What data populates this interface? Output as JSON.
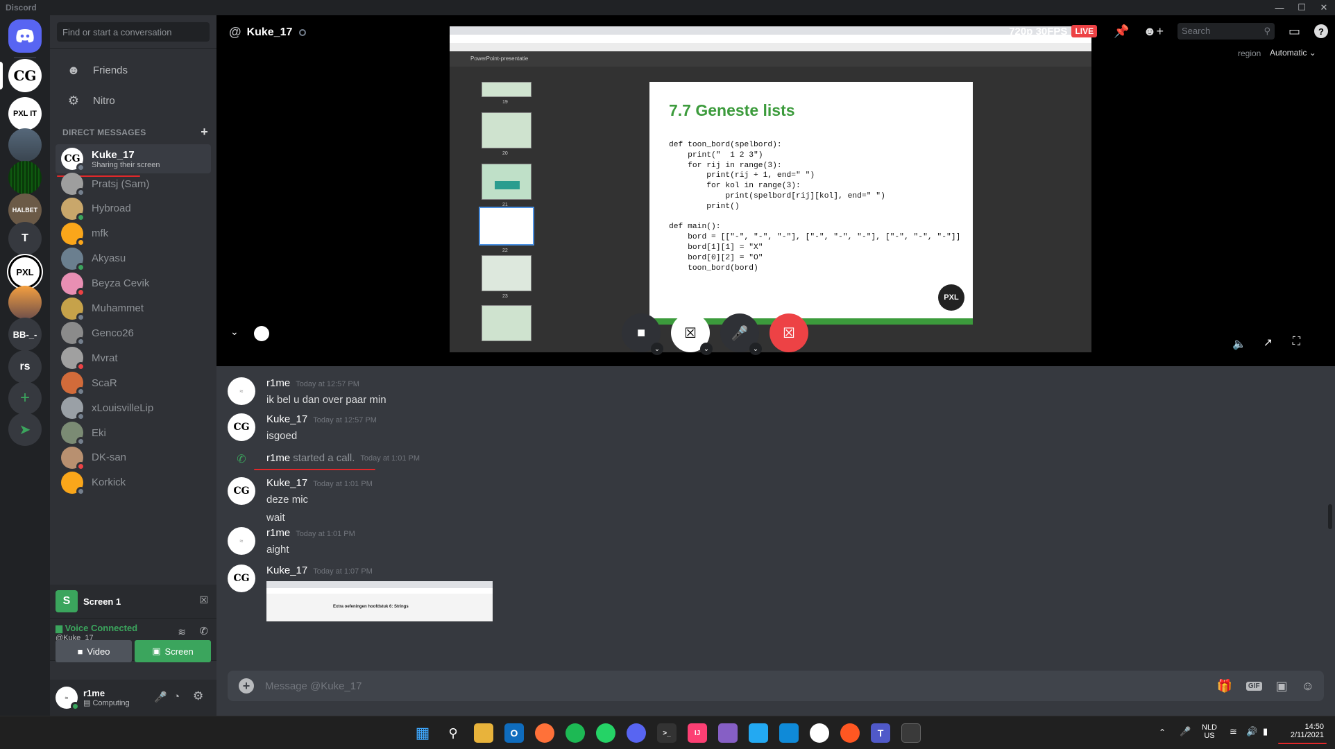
{
  "window": {
    "title": "Discord"
  },
  "servers": [
    "CG",
    "PXL IT",
    "T",
    "PXL",
    "BB-_-",
    "rs"
  ],
  "dm_sidebar": {
    "search_placeholder": "Find or start a conversation",
    "nav": [
      {
        "label": "Friends",
        "icon": "friends-icon"
      },
      {
        "label": "Nitro",
        "icon": "nitro-icon"
      }
    ],
    "header": "DIRECT MESSAGES",
    "active": {
      "name": "Kuke_17",
      "subtitle": "Sharing their screen"
    },
    "items": [
      "Pratsj (Sam)",
      "Hybroad",
      "mfk",
      "Akyasu",
      "Beyza Cevik",
      "Muhammet",
      "Genco26",
      "Mvrat",
      "ScaR",
      "xLouisvilleLip",
      "Eki",
      "DK-san",
      "Korkick"
    ]
  },
  "screen_panel": {
    "title": "Screen 1",
    "voice_status": "Voice Connected",
    "voice_channel": "@Kuke_17",
    "video_label": "Video",
    "screen_label": "Screen"
  },
  "user_panel": {
    "name": "r1me",
    "status": "Computing"
  },
  "header": {
    "channel": "Kuke_17",
    "quality": "720p 30FPS",
    "live": "LIVE",
    "search_placeholder": "Search",
    "region_label": "region",
    "region_value": "Automatic"
  },
  "slide": {
    "title": "7.7 Geneste lists",
    "code": [
      "def toon_bord(spelbord):",
      "    print(\"  1 2 3\")",
      "    for rij in range(3):",
      "        print(rij + 1, end=\" \")",
      "        for kol in range(3):",
      "            print(spelbord[rij][kol], end=\" \")",
      "        print()",
      "",
      "def main():",
      "    bord = [[\"-\", \"-\", \"-\"], [\"-\", \"-\", \"-\"], [\"-\", \"-\", \"-\"]]",
      "    bord[1][1] = \"X\"",
      "    bord[0][2] = \"O\"",
      "    toon_bord(bord)"
    ],
    "logo": "PXL",
    "thumb_labels": [
      "19",
      "20",
      "21",
      "22",
      "23"
    ],
    "app_label": "PowerPoint-presentatie"
  },
  "messages": [
    {
      "author": "r1me",
      "time": "Today at 12:57 PM",
      "lines": [
        "ik bel u dan over paar min"
      ]
    },
    {
      "author": "Kuke_17",
      "time": "Today at 12:57 PM",
      "lines": [
        "isgoed"
      ]
    },
    {
      "system": true,
      "author": "r1me",
      "text": "started a call.",
      "time": "Today at 1:01 PM"
    },
    {
      "author": "Kuke_17",
      "time": "Today at 1:01 PM",
      "lines": [
        "deze mic",
        "wait"
      ]
    },
    {
      "author": "r1me",
      "time": "Today at 1:01 PM",
      "lines": [
        "aight"
      ]
    },
    {
      "author": "Kuke_17",
      "time": "Today at 1:07 PM",
      "lines": [],
      "attachment_caption": "Extra oefeningen hoofdstuk 6: Strings"
    }
  ],
  "composer": {
    "placeholder": "Message @Kuke_17"
  },
  "taskbar": {
    "lang": "NLD",
    "region": "US",
    "time": "14:50",
    "date": "2/11/2021"
  }
}
